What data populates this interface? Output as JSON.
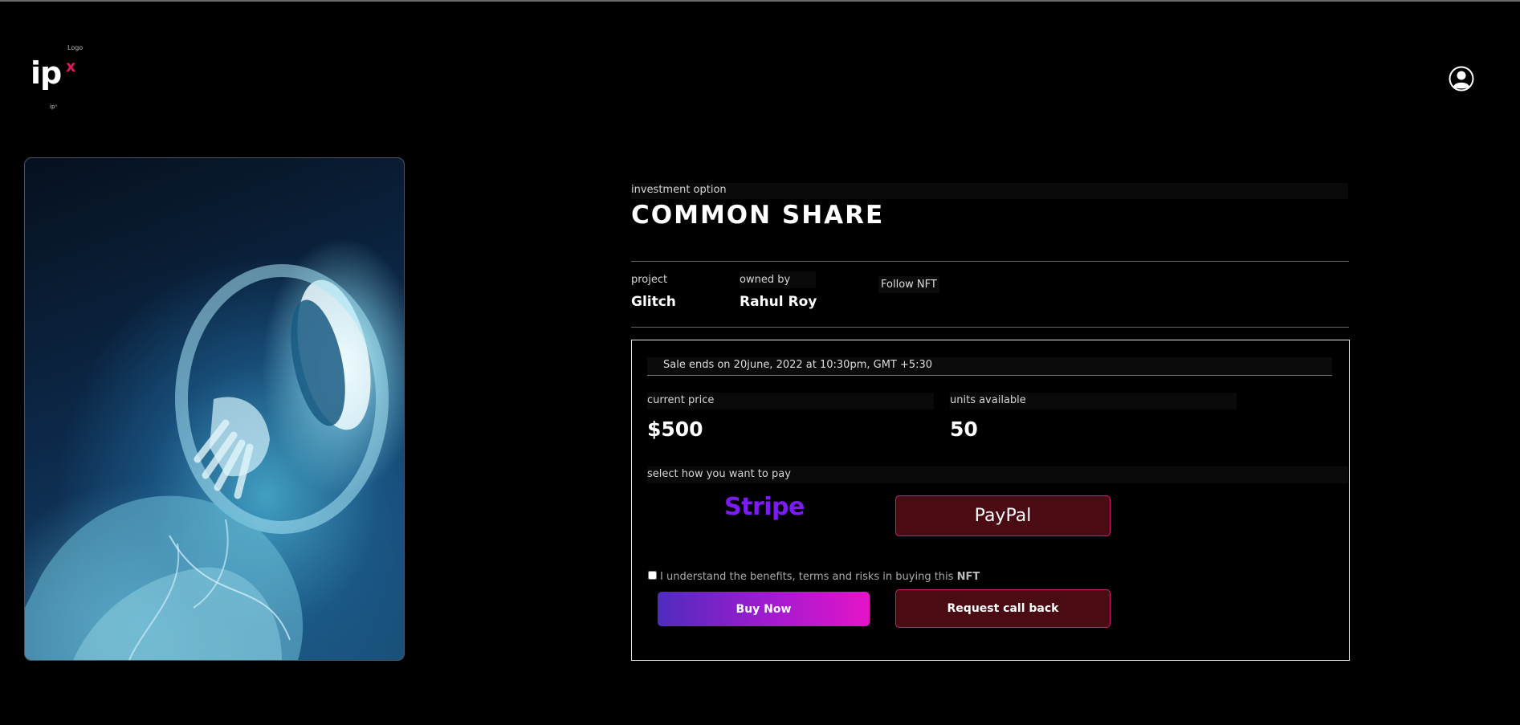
{
  "header": {
    "logo_caption": "Logo",
    "logo_text": "ip",
    "logo_superscript": "x",
    "logo_small": "ipˣ",
    "profile_icon": "user-circle-icon"
  },
  "artwork": {
    "description_icon": "nft-artwork-image"
  },
  "details": {
    "investment_label": "investment option",
    "title": "COMMON SHARE",
    "project_label": "project",
    "project_value": "Glitch",
    "owner_label": "owned by",
    "owner_value": "Rahul Roy",
    "follow_text": "Follow NFT"
  },
  "sale": {
    "ends_text": "Sale ends on 20june, 2022 at 10:30pm, GMT +5:30",
    "price_label": "current price",
    "price_value": "$500",
    "units_label": "units available",
    "units_value": "50",
    "pay_label": "select how you want to pay",
    "stripe_label": "Stripe",
    "paypal_label": "PayPal",
    "terms_text": "I understand the benefits, terms and risks in buying this ",
    "terms_strong": "NFT",
    "terms_checked": false,
    "buy_label": "Buy Now",
    "callback_label": "Request call back"
  },
  "colors": {
    "background": "#000000",
    "accent_pink": "#d6197a",
    "logo_x": "#e0195f",
    "stripe": "#7c1cf2",
    "button_dark": "#4b0b13"
  }
}
